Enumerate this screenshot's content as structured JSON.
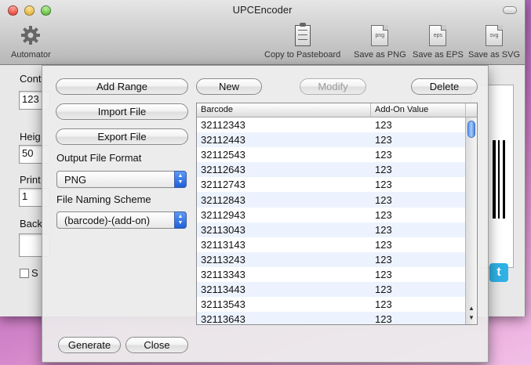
{
  "window": {
    "title": "UPCEncoder",
    "toolbar": {
      "automator": "Automator",
      "copy": "Copy to Pasteboard",
      "save_png": "Save as PNG",
      "save_eps": "Save as EPS",
      "save_svg": "Save as SVG",
      "png_icon_text": "png",
      "eps_icon_text": "eps",
      "svg_icon_text": "svg"
    },
    "background": {
      "content_label": "Cont",
      "content_value": "123",
      "height_label": "Heig",
      "height_value": "50",
      "print_label": "Print",
      "print_value": "1",
      "back_label": "Back",
      "show_label": "S"
    }
  },
  "sheet": {
    "add_range": "Add Range",
    "new": "New",
    "modify": "Modify",
    "delete": "Delete",
    "import_file": "Import File",
    "export_file": "Export File",
    "output_format_label": "Output File Format",
    "output_format_value": "PNG",
    "naming_label": "File Naming Scheme",
    "naming_value": "(barcode)-(add-on)",
    "generate": "Generate",
    "close": "Close"
  },
  "table": {
    "columns": [
      "Barcode",
      "Add-On Value"
    ],
    "rows": [
      [
        "32112343",
        "123"
      ],
      [
        "32112443",
        "123"
      ],
      [
        "32112543",
        "123"
      ],
      [
        "32112643",
        "123"
      ],
      [
        "32112743",
        "123"
      ],
      [
        "32112843",
        "123"
      ],
      [
        "32112943",
        "123"
      ],
      [
        "32113043",
        "123"
      ],
      [
        "32113143",
        "123"
      ],
      [
        "32113243",
        "123"
      ],
      [
        "32113343",
        "123"
      ],
      [
        "32113443",
        "123"
      ],
      [
        "32113543",
        "123"
      ],
      [
        "32113643",
        "123"
      ]
    ]
  },
  "icons": {
    "automator": "gear-icon",
    "copy": "clipboard-icon",
    "twitter": "twitter-icon"
  }
}
